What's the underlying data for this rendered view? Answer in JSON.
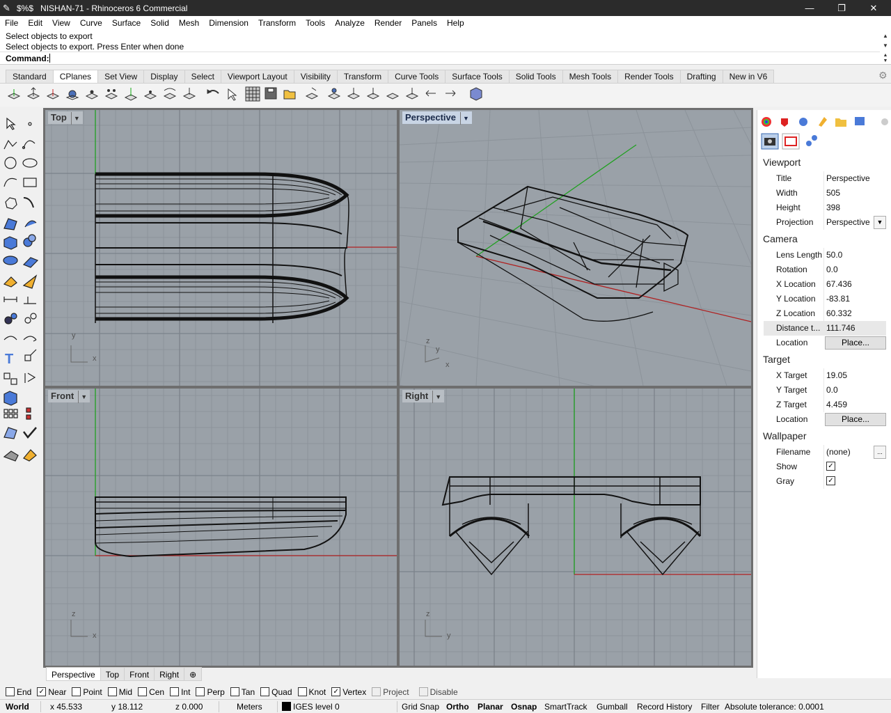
{
  "titlebar": {
    "app_glyph": "$%$",
    "title": "NISHAN-71 - Rhinoceros 6 Commercial",
    "minimize": "—",
    "restore": "❐",
    "close": "✕"
  },
  "menu": [
    "File",
    "Edit",
    "View",
    "Curve",
    "Surface",
    "Solid",
    "Mesh",
    "Dimension",
    "Transform",
    "Tools",
    "Analyze",
    "Render",
    "Panels",
    "Help"
  ],
  "command": {
    "history1": "Select objects to export",
    "history2": "Select objects to export. Press Enter when done",
    "prompt": "Command:"
  },
  "toolbar_tabs": [
    "Standard",
    "CPlanes",
    "Set View",
    "Display",
    "Select",
    "Viewport Layout",
    "Visibility",
    "Transform",
    "Curve Tools",
    "Surface Tools",
    "Solid Tools",
    "Mesh Tools",
    "Render Tools",
    "Drafting",
    "New in V6"
  ],
  "active_tab": "CPlanes",
  "viewports": {
    "top": {
      "label": "Top",
      "axis_a": "y",
      "axis_b": "x"
    },
    "perspective": {
      "label": "Perspective",
      "axis_a": "z",
      "axis_b": "y",
      "axis_c": "x"
    },
    "front": {
      "label": "Front",
      "axis_a": "z",
      "axis_b": "x"
    },
    "right": {
      "label": "Right",
      "axis_a": "z",
      "axis_b": "y"
    }
  },
  "view_tabs": [
    "Perspective",
    "Top",
    "Front",
    "Right"
  ],
  "view_tabs_add": "⊕",
  "panel": {
    "viewport_header": "Viewport",
    "title_k": "Title",
    "title_v": "Perspective",
    "width_k": "Width",
    "width_v": "505",
    "height_k": "Height",
    "height_v": "398",
    "projection_k": "Projection",
    "projection_v": "Perspective",
    "camera_header": "Camera",
    "lens_k": "Lens Length",
    "lens_v": "50.0",
    "rotation_k": "Rotation",
    "rotation_v": "0.0",
    "xloc_k": "X Location",
    "xloc_v": "67.436",
    "yloc_k": "Y Location",
    "yloc_v": "-83.81",
    "zloc_k": "Z Location",
    "zloc_v": "60.332",
    "dist_k": "Distance t...",
    "dist_v": "111.746",
    "loc_k": "Location",
    "loc_btn": "Place...",
    "target_header": "Target",
    "xt_k": "X Target",
    "xt_v": "19.05",
    "yt_k": "Y Target",
    "yt_v": "0.0",
    "zt_k": "Z Target",
    "zt_v": "4.459",
    "tloc_k": "Location",
    "tloc_btn": "Place...",
    "wallpaper_header": "Wallpaper",
    "file_k": "Filename",
    "file_v": "(none)",
    "file_btn": "...",
    "show_k": "Show",
    "gray_k": "Gray"
  },
  "osnap": [
    {
      "label": "End",
      "checked": false
    },
    {
      "label": "Near",
      "checked": true
    },
    {
      "label": "Point",
      "checked": false
    },
    {
      "label": "Mid",
      "checked": false
    },
    {
      "label": "Cen",
      "checked": false
    },
    {
      "label": "Int",
      "checked": false
    },
    {
      "label": "Perp",
      "checked": false
    },
    {
      "label": "Tan",
      "checked": false
    },
    {
      "label": "Quad",
      "checked": false
    },
    {
      "label": "Knot",
      "checked": false
    },
    {
      "label": "Vertex",
      "checked": true
    },
    {
      "label": "Project",
      "checked": false
    },
    {
      "label": "Disable",
      "checked": false
    }
  ],
  "status": {
    "cplane": "World",
    "x": "x 45.533",
    "y": "y 18.112",
    "z": "z 0.000",
    "units": "Meters",
    "layer": "IGES level 0",
    "grid_snap": "Grid Snap",
    "ortho": "Ortho",
    "planar": "Planar",
    "osnap": "Osnap",
    "smarttrack": "SmartTrack",
    "gumball": "Gumball",
    "record": "Record History",
    "filter": "Filter",
    "tolerance": "Absolute tolerance: 0.0001"
  },
  "colors": {
    "viewport_bg": "#9aa1a8",
    "grid_line": "#8a9198",
    "x_axis": "#b02020",
    "y_axis": "#20a020",
    "active_label": "#c8d4e4"
  }
}
